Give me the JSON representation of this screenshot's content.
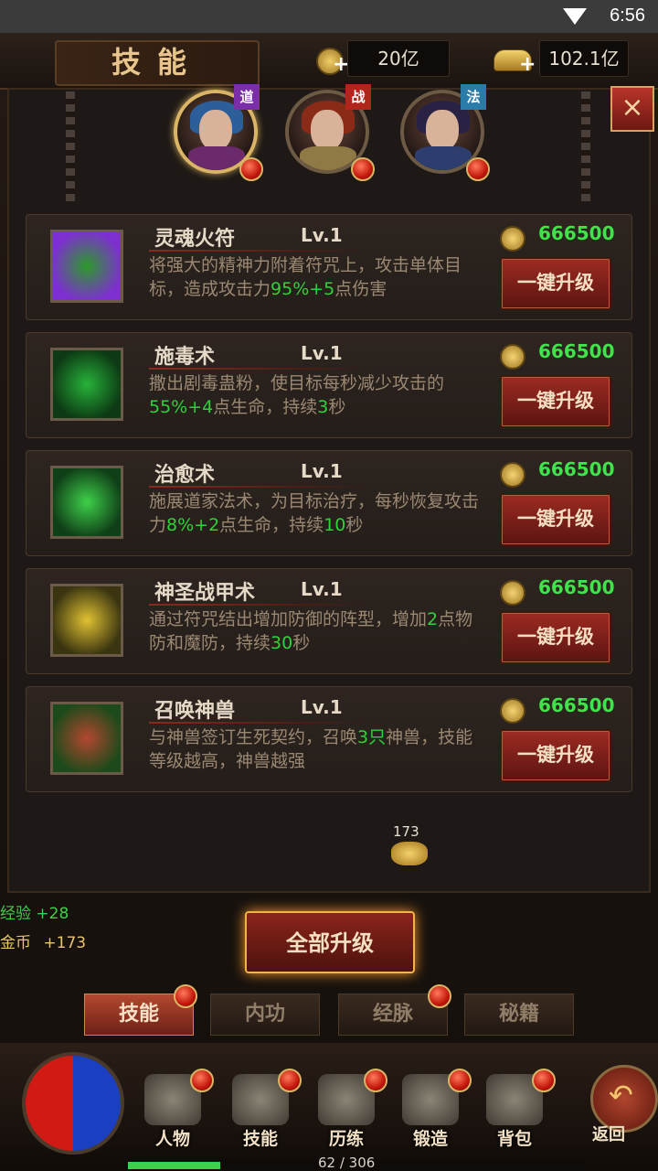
{
  "status": {
    "time": "6:56"
  },
  "header": {
    "title": "技能",
    "copper": "20亿",
    "gold": "102.1亿",
    "close": "×"
  },
  "classes": [
    {
      "badge": "道",
      "badge_color": "#7a2fa8",
      "active": true,
      "hair": "#2c5f9a",
      "armor": "#6a2a6b"
    },
    {
      "badge": "战",
      "badge_color": "#b2251c",
      "active": false,
      "hair": "#8a2b18",
      "armor": "#8f7a45"
    },
    {
      "badge": "法",
      "badge_color": "#2a7ba8",
      "active": false,
      "hair": "#2a2244",
      "armor": "#2d3d6d"
    }
  ],
  "skills": [
    {
      "name": "灵魂火符",
      "level": "Lv.1",
      "cost": "666500",
      "button": "一键升级",
      "desc": [
        {
          "t": "将强大的精神力附着符咒上，攻击单体目标，造成攻击力"
        },
        {
          "t": "95%+5",
          "g": true
        },
        {
          "t": "点伤害"
        }
      ],
      "icon_colors": [
        "#7d2fd0",
        "#2c9a2a"
      ]
    },
    {
      "name": "施毒术",
      "level": "Lv.1",
      "cost": "666500",
      "button": "一键升级",
      "desc": [
        {
          "t": "撒出剧毒蛊粉，使目标每秒减少攻击的"
        },
        {
          "t": "55%+4",
          "g": true
        },
        {
          "t": "点生命，持续"
        },
        {
          "t": "3",
          "g": true
        },
        {
          "t": "秒"
        }
      ],
      "icon_colors": [
        "#0d3a14",
        "#27b33a"
      ]
    },
    {
      "name": "治愈术",
      "level": "Lv.1",
      "cost": "666500",
      "button": "一键升级",
      "desc": [
        {
          "t": "施展道家法术，为目标治疗，每秒恢复攻击力"
        },
        {
          "t": "8%+2",
          "g": true
        },
        {
          "t": "点生命，持续"
        },
        {
          "t": "10",
          "g": true
        },
        {
          "t": "秒"
        }
      ],
      "icon_colors": [
        "#0f3f17",
        "#3fd04a"
      ]
    },
    {
      "name": "神圣战甲术",
      "level": "Lv.1",
      "cost": "666500",
      "button": "一键升级",
      "desc": [
        {
          "t": "通过符咒结出增加防御的阵型，增加"
        },
        {
          "t": "2",
          "g": true
        },
        {
          "t": "点物防和魔防，持续"
        },
        {
          "t": "30",
          "g": true
        },
        {
          "t": "秒"
        }
      ],
      "icon_colors": [
        "#3a3410",
        "#e0c232"
      ]
    },
    {
      "name": "召唤神兽",
      "level": "Lv.1",
      "cost": "666500",
      "button": "一键升级",
      "desc": [
        {
          "t": "与神兽签订生死契约，召唤"
        },
        {
          "t": "3只",
          "g": true
        },
        {
          "t": "神兽，技能等级越高，神兽越强"
        }
      ],
      "icon_colors": [
        "#1d4a1a",
        "#b3472f"
      ]
    }
  ],
  "loot": {
    "count": "173"
  },
  "logs": [
    {
      "label": "经验",
      "value": "+28",
      "color": "#3ed04a"
    },
    {
      "label": "金币",
      "value": "+173",
      "color": "#e9c46a"
    }
  ],
  "upgrade_all": "全部升级",
  "tabs": [
    {
      "label": "技能",
      "active": true,
      "dot": true
    },
    {
      "label": "内功",
      "active": false,
      "dot": false
    },
    {
      "label": "经脉",
      "active": false,
      "dot": true
    },
    {
      "label": "秘籍",
      "active": false,
      "dot": false
    }
  ],
  "menu": [
    {
      "label": "人物",
      "icon": "helmet-icon"
    },
    {
      "label": "技能",
      "icon": "skill-book-icon"
    },
    {
      "label": "历练",
      "icon": "armor-icon"
    },
    {
      "label": "锻造",
      "icon": "anvil-icon"
    },
    {
      "label": "背包",
      "icon": "bag-icon"
    }
  ],
  "back": {
    "label": "返回"
  },
  "xp": {
    "text": "62 / 306",
    "fraction": 0.2026
  }
}
